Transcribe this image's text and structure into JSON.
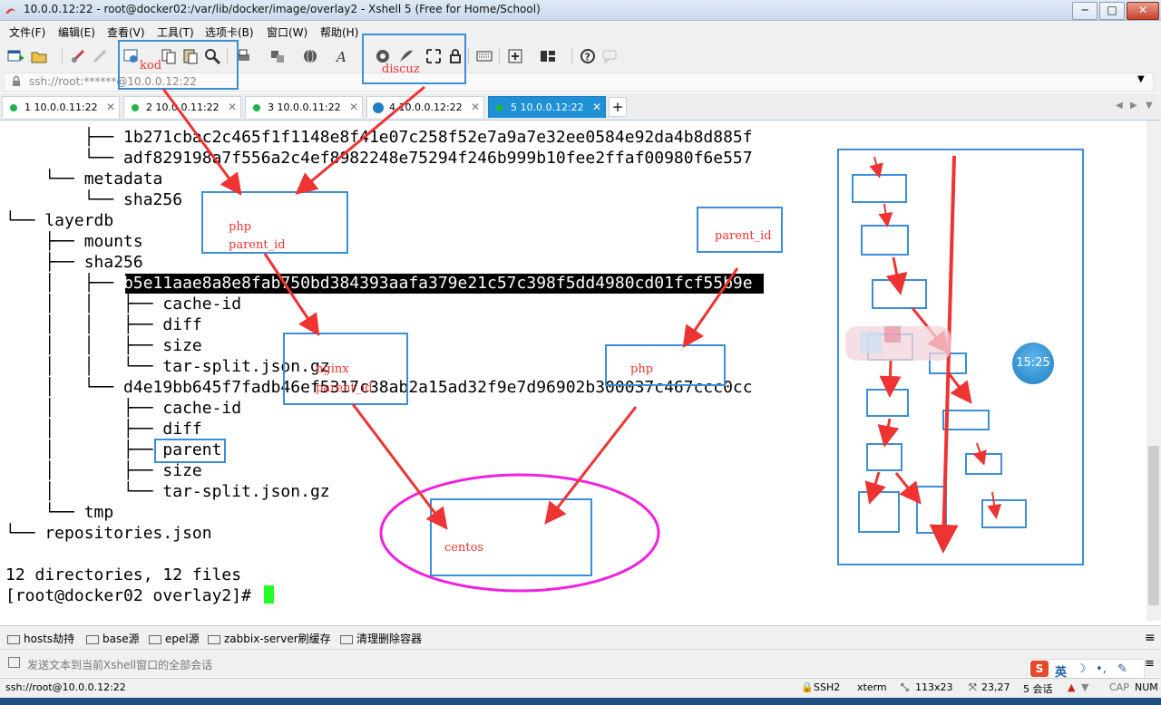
{
  "window": {
    "title": "10.0.0.12:22 - root@docker02:/var/lib/docker/image/overlay2 - Xshell 5 (Free for Home/School)",
    "minimize": "─",
    "maximize": "□",
    "close": "✕"
  },
  "menu": [
    "文件(F)",
    "编辑(E)",
    "查看(V)",
    "工具(T)",
    "选项卡(B)",
    "窗口(W)",
    "帮助(H)"
  ],
  "toolbar": {
    "icons": [
      "new-session-icon",
      "open-folder-icon",
      "properties-icon",
      "disconnect-icon",
      "settings-icon",
      "copy-icon",
      "paste-icon",
      "find-icon",
      "print-icon",
      "transfer-icon",
      "globe-icon",
      "font-icon",
      "xftp-icon",
      "xmanager-icon",
      "fullscreen-icon",
      "lock-icon",
      "keyboard-icon",
      "add-icon",
      "layout-icon",
      "help-icon",
      "chat-icon"
    ]
  },
  "address": {
    "value": "ssh://root:******@10.0.0.12:22"
  },
  "tabs": [
    {
      "label": "1 10.0.0.11:22",
      "status": "green"
    },
    {
      "label": "2 10.0.0.11:22",
      "status": "green"
    },
    {
      "label": "3 10.0.0.11:22",
      "status": "green"
    },
    {
      "label": "4 10.0.0.12:22",
      "status": "alert"
    },
    {
      "label": "5 10.0.0.12:22",
      "status": "green",
      "active": true
    }
  ],
  "tab_add": "+",
  "terminal": {
    "lines": [
      "        ├── 1b271cbac2c465f1f1148e8f41e07c258f52e7a9a7e32ee0584e92da4b8d885f",
      "        └── adf829198a7f556a2c4ef8982248e75294f246b999b10fee2ffaf00980f6e557",
      "    └── metadata",
      "        └── sha256",
      "└── layerdb",
      "    ├── mounts",
      "    ├── sha256",
      "    │   ├── b5e11aae8a8e8fab750bd384393aafa379e21c57c398f5dd4980cd01fcf55b9e",
      "    │   │   ├── cache-id",
      "    │   │   ├── diff",
      "    │   │   ├── size",
      "    │   │   └── tar-split.json.gz",
      "    │   └── d4e19bb645f7fadb46ef5317c38ab2a15ad32f9e7d96902b300037c467ccc0cc",
      "    │       ├── cache-id",
      "    │       ├── diff",
      "    │       ├── parent",
      "    │       ├── size",
      "    │       └── tar-split.json.gz",
      "    └── tmp",
      "└── repositories.json",
      "",
      "12 directories, 12 files",
      "[root@docker02 overlay2]# "
    ]
  },
  "annotations": {
    "kod": "kod",
    "discuz": "discuz",
    "php_top": "php",
    "parent_id_1": "parent_id",
    "parent_id_2": "parent_id",
    "nginx": "nginx",
    "parent_id_3": "parent_id",
    "php_right": "php",
    "centos": "centos",
    "clock": "15:25"
  },
  "quick_commands": [
    "hosts劫持",
    "base源",
    "epel源",
    "zabbix-server刷缓存",
    "清理删除容器"
  ],
  "compose": {
    "placeholder": "发送文本到当前Xshell窗口的全部会话"
  },
  "status": {
    "connection": "ssh://root@10.0.0.12:22",
    "protocol": "SSH2",
    "term": "xterm",
    "size": "113x23",
    "cursor": "23,27",
    "sessions": "5 会话",
    "caps": "CAP",
    "num": "NUM",
    "ime": "英"
  },
  "colors": {
    "accent": "#1e90d6",
    "annotation_red": "#ee3333",
    "annotation_blue": "#3b8ed8",
    "ellipse": "#ee22dd",
    "cursor": "#22ff22"
  }
}
